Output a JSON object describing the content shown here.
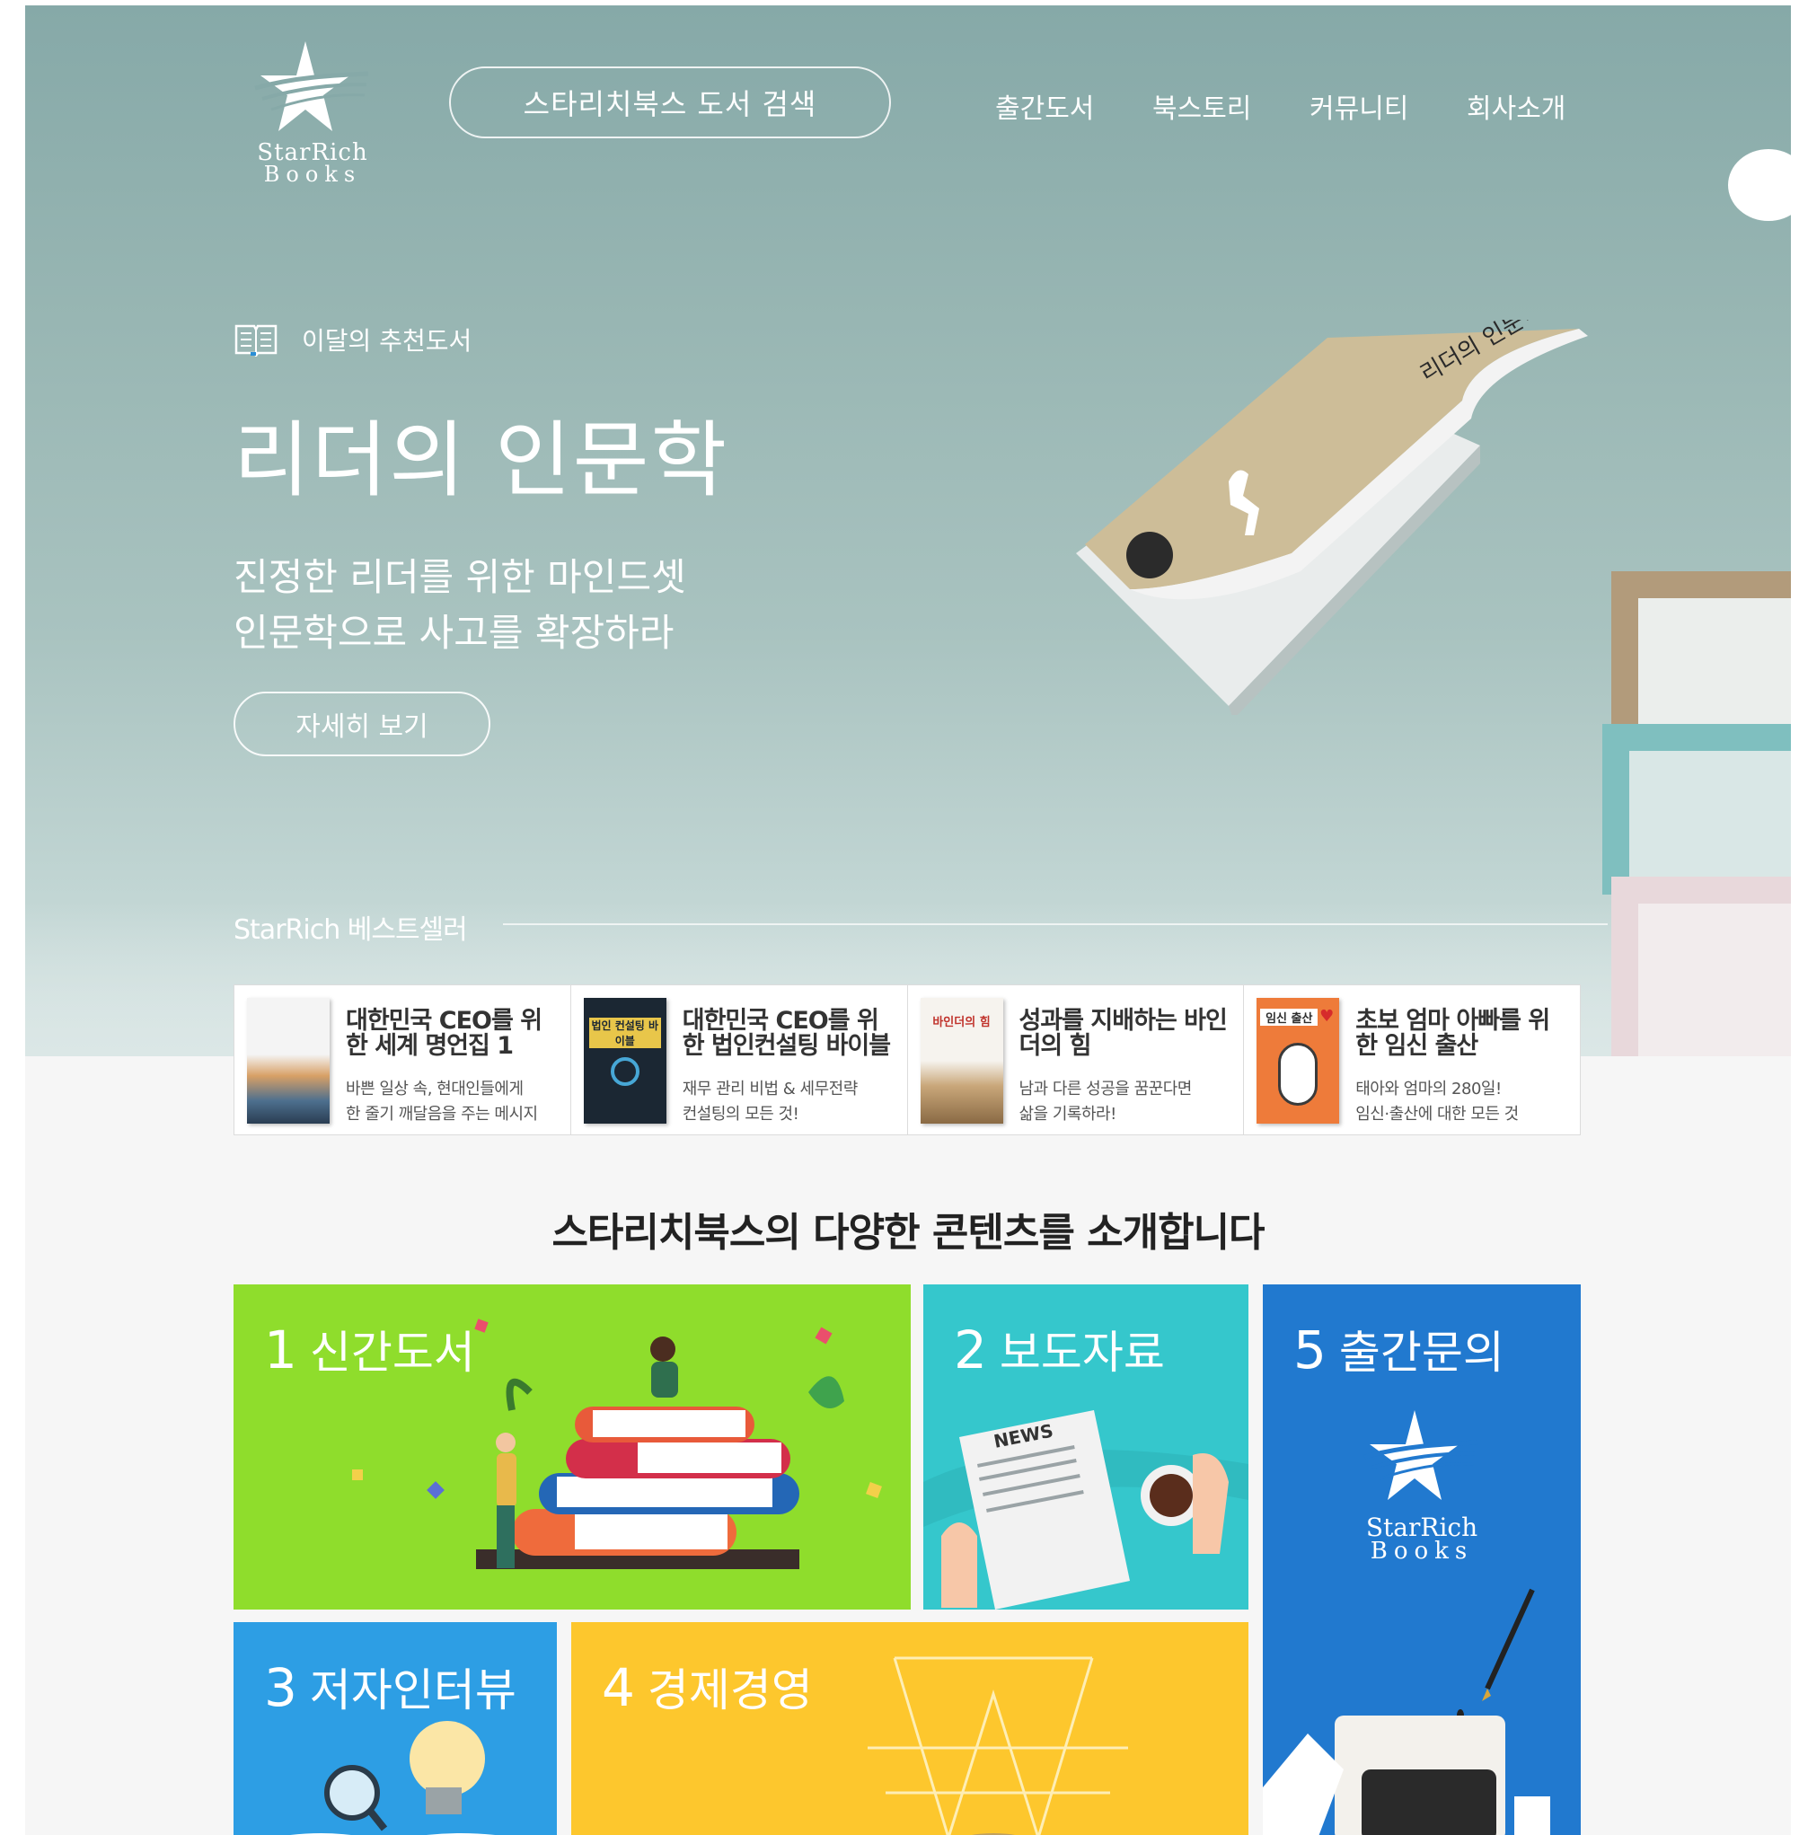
{
  "header": {
    "logo_line1": "StarRich",
    "logo_line2": "Books",
    "search_label": "스타리치북스 도서 검색",
    "nav": [
      "출간도서",
      "북스토리",
      "커뮤니티",
      "회사소개"
    ]
  },
  "hero": {
    "tag": "이달의 추천도서",
    "title": "리더의 인문학",
    "subtitle_line1": "진정한 리더를 위한 마인드셋",
    "subtitle_line2": "인문학으로 사고를 확장하라",
    "more_label": "자세히 보기",
    "book_cover_title": "리더의 인문학"
  },
  "bestsellers": {
    "heading": "StarRich 베스트셀러",
    "items": [
      {
        "title_line1": "대한민국 CEO를 위",
        "title_line2": "한 세계 명언집 1",
        "desc_line1": "바쁜 일상 속, 현대인들에게",
        "desc_line2": "한 줄기 깨달음을 주는 메시지"
      },
      {
        "title_line1": "대한민국 CEO를 위",
        "title_line2": "한 법인컨설팅 바이블",
        "desc_line1": "재무 관리 비법 & 세무전략",
        "desc_line2": "컨설팅의 모든 것!"
      },
      {
        "title_line1": "성과를 지배하는 바인",
        "title_line2": "더의 힘",
        "desc_line1": "남과 다른 성공을 꿈꾼다면",
        "desc_line2": "삶을 기록하라!"
      },
      {
        "title_line1": "초보 엄마 아빠를 위",
        "title_line2": "한 임신 출산",
        "desc_line1": "태아와 엄마의 280일!",
        "desc_line2": "임신·출산에 대한 모든 것"
      }
    ],
    "cover_texts": [
      "법인 컨설팅 바이블",
      "바인더의 힘",
      "임신 출산"
    ]
  },
  "contents": {
    "title_pre": "스타리치북스의 ",
    "title_bold": "다양한 콘텐츠",
    "title_post": "를 소개합니다",
    "tiles": [
      {
        "num": "1",
        "label": "신간도서"
      },
      {
        "num": "2",
        "label": "보도자료"
      },
      {
        "num": "3",
        "label": "저자인터뷰"
      },
      {
        "num": "4",
        "label": "경제경영"
      },
      {
        "num": "5",
        "label": "출간문의"
      }
    ],
    "news_text": "NEWS"
  },
  "colors": {
    "tile1": "#8fdd2c",
    "tile2": "#35c7cc",
    "tile3": "#2d9ee4",
    "tile4": "#fdc72d",
    "tile5": "#2179cf"
  }
}
